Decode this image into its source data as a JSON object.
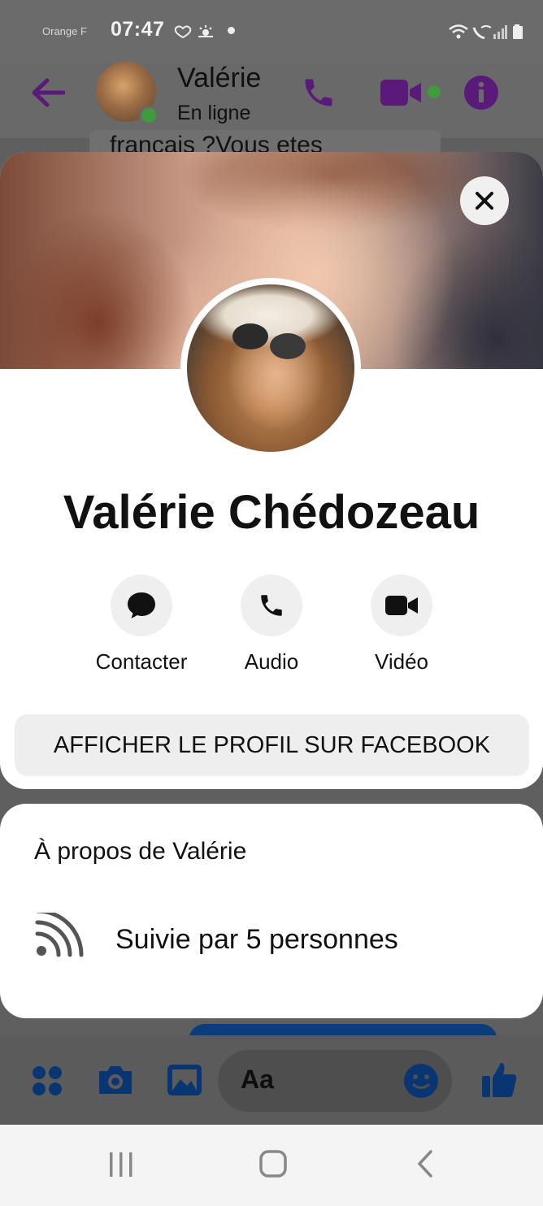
{
  "status_bar": {
    "carrier": "Orange F",
    "time": "07:47"
  },
  "chat_header": {
    "name": "Valérie",
    "status": "En ligne"
  },
  "chat": {
    "partial_message": "francais ?Vous etes"
  },
  "composer": {
    "input_placeholder": "Aa"
  },
  "profile": {
    "full_name": "Valérie Chédozeau",
    "actions": [
      {
        "label": "Contacter",
        "icon": "message-bubble-icon"
      },
      {
        "label": "Audio",
        "icon": "phone-icon"
      },
      {
        "label": "Vidéo",
        "icon": "video-camera-icon"
      }
    ],
    "facebook_button": "AFFICHER LE PROFIL SUR FACEBOOK"
  },
  "about": {
    "title": "À propos de Valérie",
    "followers_text": "Suivie par 5 personnes"
  },
  "colors": {
    "messenger_purple": "#5a1a7a",
    "messenger_blue": "#0a3573",
    "online_green": "#3e9c3a"
  }
}
